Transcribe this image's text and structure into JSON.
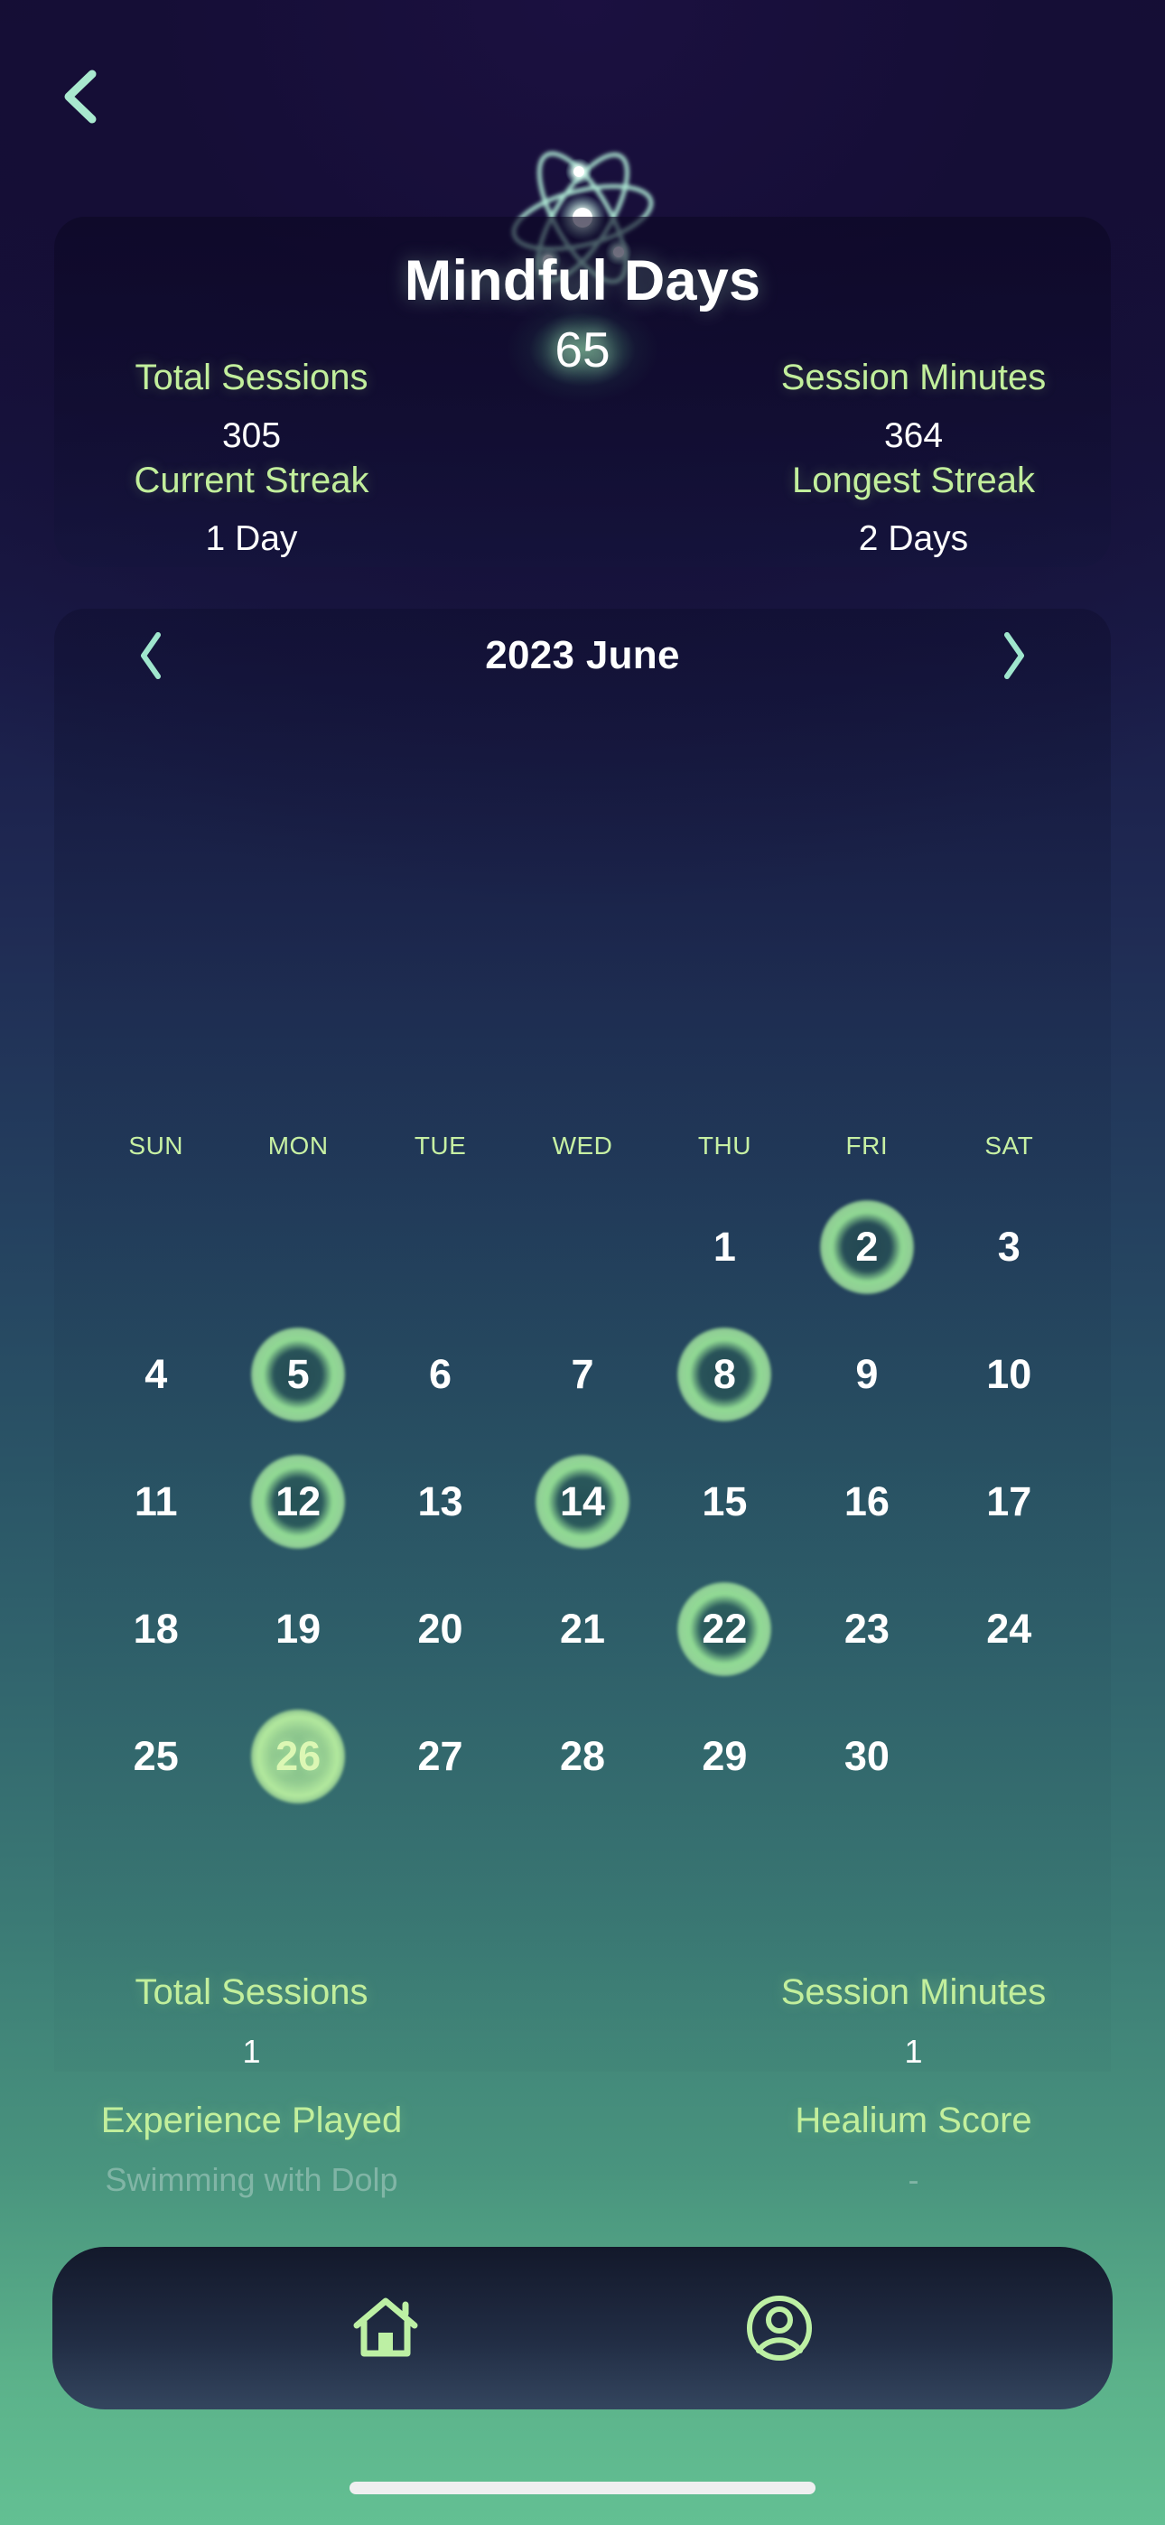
{
  "header": {
    "back_icon": "chevron-left-icon",
    "logo_icon": "atom-icon"
  },
  "summary": {
    "title": "Mindful Days",
    "days_count": "65",
    "metrics": [
      {
        "label": "Total Sessions",
        "value": "305"
      },
      {
        "label": "Session Minutes",
        "value": "364"
      },
      {
        "label": "Current Streak",
        "value": "1 Day"
      },
      {
        "label": "Longest Streak",
        "value": "2 Days"
      }
    ]
  },
  "calendar": {
    "prev_icon": "chevron-left-icon",
    "next_icon": "chevron-right-icon",
    "title": "2023 June",
    "weekdays": [
      "SUN",
      "MON",
      "TUE",
      "WED",
      "THU",
      "FRI",
      "SAT"
    ],
    "leading_blanks": 4,
    "days": [
      1,
      2,
      3,
      4,
      5,
      6,
      7,
      8,
      9,
      10,
      11,
      12,
      13,
      14,
      15,
      16,
      17,
      18,
      19,
      20,
      21,
      22,
      23,
      24,
      25,
      26,
      27,
      28,
      29,
      30
    ],
    "marked_days": [
      2,
      5,
      8,
      12,
      14,
      22,
      26
    ],
    "today": 26
  },
  "day_details": {
    "metrics": [
      {
        "label": "Total Sessions",
        "value": "1"
      },
      {
        "label": "Session Minutes",
        "value": "1"
      },
      {
        "label": "Experience Played",
        "value": "Swimming with Dolp"
      },
      {
        "label": "Healium Score",
        "value": "-"
      }
    ]
  },
  "bottom_nav": {
    "items": [
      {
        "name": "home",
        "icon": "home-icon"
      },
      {
        "name": "profile",
        "icon": "user-circle-icon"
      }
    ]
  },
  "colors": {
    "accent_green": "#c2ef9c",
    "bright_green": "#b9ef9f",
    "text_white": "#ffffff",
    "bg_top": "#140d33",
    "bg_bottom": "#63c093"
  }
}
